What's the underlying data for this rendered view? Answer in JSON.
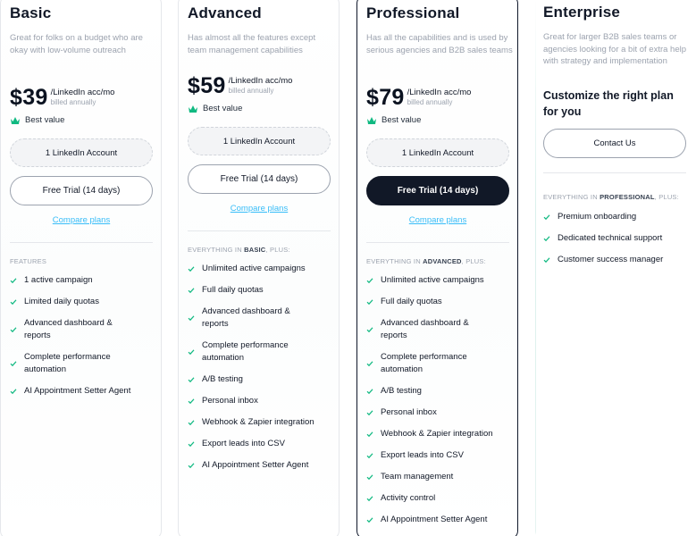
{
  "plans": [
    {
      "name": "Basic",
      "description": "Great for folks on a budget who are okay with low-volume outreach",
      "price": "$39",
      "unit": "/LinkedIn acc/mo",
      "billed": "billed annually",
      "best_value": "Best value",
      "accounts": "1 LinkedIn Account",
      "trial": "Free Trial (14 days)",
      "compare": "Compare plans",
      "section_label": "FEATURES",
      "features": [
        "1 active campaign",
        "Limited daily quotas",
        "Advanced dashboard & reports",
        "Complete performance automation",
        "AI Appointment Setter Agent"
      ]
    },
    {
      "name": "Advanced",
      "description": "Has almost all the features except team management capabilities",
      "price": "$59",
      "unit": "/LinkedIn acc/mo",
      "billed": "billed annually",
      "best_value": "Best value",
      "accounts": "1 LinkedIn Account",
      "trial": "Free Trial (14 days)",
      "compare": "Compare plans",
      "section_prefix": "EVERYTHING IN ",
      "section_plan": "BASIC",
      "section_suffix": ", PLUS:",
      "features": [
        "Unlimited active campaigns",
        "Full daily quotas",
        "Advanced dashboard & reports",
        "Complete performance automation",
        "A/B testing",
        "Personal inbox",
        "Webhook & Zapier integration",
        "Export leads into CSV",
        "AI Appointment Setter Agent"
      ]
    },
    {
      "name": "Professional",
      "description": "Has all the capabilities and is used by serious agencies and B2B sales teams",
      "price": "$79",
      "unit": "/LinkedIn acc/mo",
      "billed": "billed annually",
      "best_value": "Best value",
      "accounts": "1 LinkedIn Account",
      "trial": "Free Trial (14 days)",
      "compare": "Compare plans",
      "section_prefix": "EVERYTHING IN ",
      "section_plan": "ADVANCED",
      "section_suffix": ", PLUS:",
      "features": [
        "Unlimited active campaigns",
        "Full daily quotas",
        "Advanced dashboard & reports",
        "Complete performance automation",
        "A/B testing",
        "Personal inbox",
        "Webhook & Zapier integration",
        "Export leads into CSV",
        "Team management",
        "Activity control",
        "AI Appointment Setter Agent"
      ]
    },
    {
      "name": "Enterprise",
      "description": "Great for larger B2B sales teams or agencies looking for a bit of extra help with strategy and implementation",
      "custom_title": "Customize the right plan for you",
      "contact": "Contact Us",
      "section_prefix": "EVERYTHING IN ",
      "section_plan": "PROFESSIONAL",
      "section_suffix": ", PLUS:",
      "features": [
        "Premium onboarding",
        "Dedicated technical support",
        "Customer success manager"
      ]
    }
  ],
  "colors": {
    "accent_green": "#10b981",
    "link_blue": "#38bdf8",
    "dark_button": "#111827"
  },
  "icons": {
    "check": "check-icon",
    "crown": "crown-icon"
  }
}
